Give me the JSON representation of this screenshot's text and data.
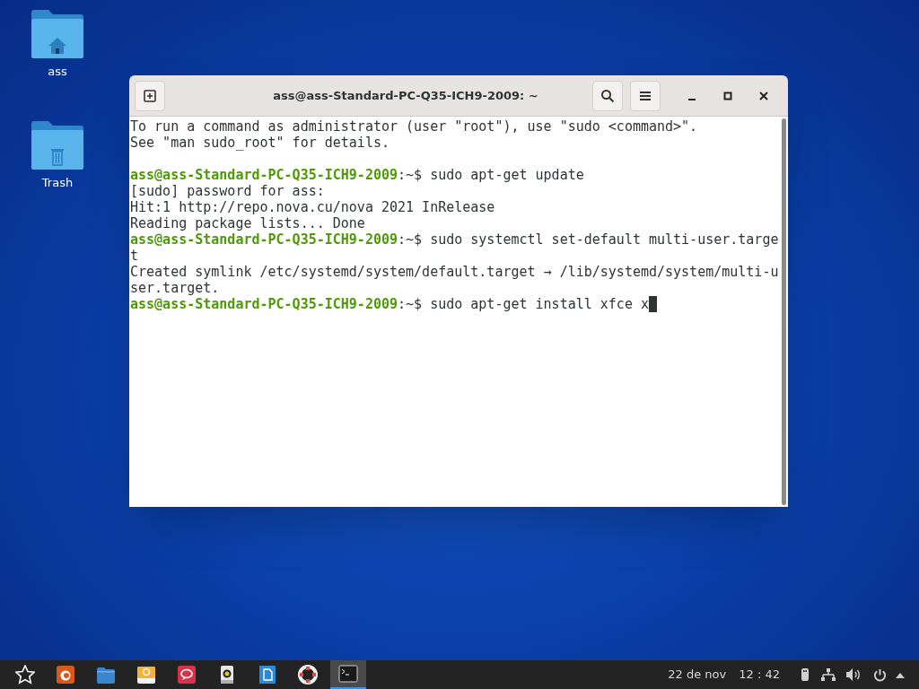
{
  "desktop_icons": [
    {
      "kind": "home",
      "label": "ass"
    },
    {
      "kind": "trash",
      "label": "Trash"
    }
  ],
  "window": {
    "title": "ass@ass-Standard-PC-Q35-ICH9-2009: ~"
  },
  "terminal_lines": [
    {
      "kind": "output",
      "text": "To run a command as administrator (user \"root\"), use \"sudo <command>\"."
    },
    {
      "kind": "output",
      "text": "See \"man sudo_root\" for details."
    },
    {
      "kind": "blank"
    },
    {
      "kind": "prompt",
      "prompt": "ass@ass-Standard-PC-Q35-ICH9-2009",
      "path": ":~$",
      "command": " sudo apt-get update"
    },
    {
      "kind": "output",
      "text": "[sudo] password for ass:"
    },
    {
      "kind": "output",
      "text": "Hit:1 http://repo.nova.cu/nova 2021 InRelease"
    },
    {
      "kind": "output",
      "text": "Reading package lists... Done"
    },
    {
      "kind": "prompt",
      "prompt": "ass@ass-Standard-PC-Q35-ICH9-2009",
      "path": ":~$",
      "command": " sudo systemctl set-default multi-user.targe"
    },
    {
      "kind": "output",
      "text": "t"
    },
    {
      "kind": "output",
      "text": "Created symlink /etc/systemd/system/default.target → /lib/systemd/system/multi-u"
    },
    {
      "kind": "output",
      "text": "ser.target."
    },
    {
      "kind": "prompt",
      "prompt": "ass@ass-Standard-PC-Q35-ICH9-2009",
      "path": ":~$",
      "command": " sudo apt-get install xfce x",
      "cursor": true
    }
  ],
  "taskbar": {
    "apps": [
      {
        "kind": "star",
        "selected": false
      },
      {
        "kind": "browser",
        "selected": false
      },
      {
        "kind": "files",
        "selected": false
      },
      {
        "kind": "mail",
        "selected": false
      },
      {
        "kind": "chat",
        "selected": false
      },
      {
        "kind": "music",
        "selected": false
      },
      {
        "kind": "document",
        "selected": false
      },
      {
        "kind": "help",
        "selected": false
      },
      {
        "kind": "terminal",
        "selected": true
      }
    ],
    "date": "22 de nov",
    "time": "12 : 42"
  }
}
